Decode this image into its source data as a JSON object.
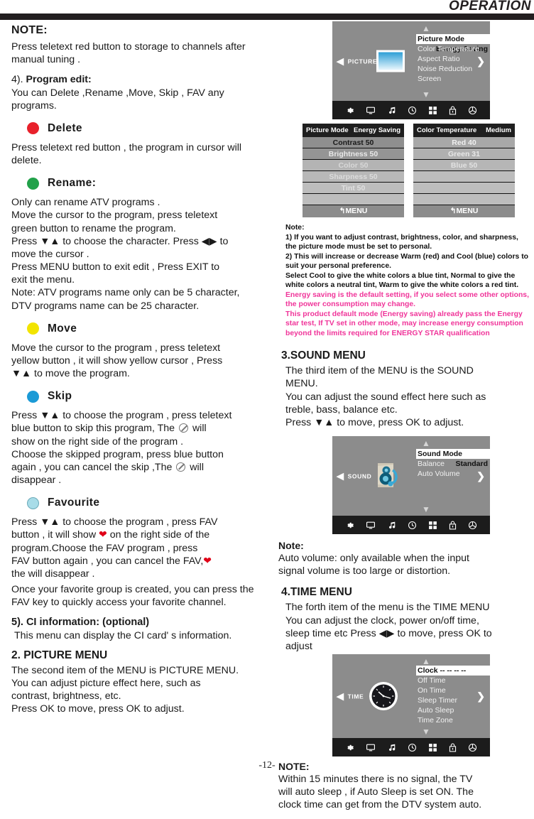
{
  "header": {
    "title": "OPERATION"
  },
  "page_number": "-12-",
  "left_column": {
    "note_heading": "NOTE:",
    "note_text": "Press  teletext red  button to storage to channels after manual tuning .",
    "program_edit": {
      "number": "4). ",
      "title": "Program  edit:",
      "text": "You can Delete ,Rename ,Move, Skip , FAV any programs."
    },
    "delete": {
      "dot_color": "#e8212b",
      "label": "Delete",
      "text": "Press  teletext red button , the  program in cursor will delete."
    },
    "rename": {
      "dot_color": "#22a14a",
      "label": "Rename:",
      "lines": [
        "Only can rename ATV programs .",
        "Move the cursor to the program, press teletext",
        "green button to rename the program.",
        "Press ▼▲ to choose the character.  Press ◀▶ to",
        "move the cursor .",
        "Press MENU button  to exit edit  , Press  EXIT to",
        "exit  the menu.",
        "Note: ATV programs name only can be 5 character,",
        "DTV programs name can  be 25  character."
      ]
    },
    "move": {
      "dot_color": "#f2e400",
      "label": "Move",
      "lines": [
        "Move the cursor to the program , press teletext",
        "yellow button , it will show yellow  cursor , Press",
        "▼▲ to move the program."
      ]
    },
    "skip": {
      "dot_color": "#1b9ad6",
      "label": "Skip",
      "line1": "Press ▼▲ to choose the program , press teletext",
      "line2a": "blue button to skip this program, The",
      "line2b": "will",
      "line3": "show on the right side of the program .",
      "line4": "Choose  the skipped program, press  blue button",
      "line5a": "again , you can  cancel the skip ,The",
      "line5b": "will",
      "line6": "disappear ."
    },
    "favourite": {
      "dot_color": "#a8dce8",
      "label": "Favourite",
      "line1a": "Press ▼▲ to choose the program , press FAV",
      "line2a": "button , it will show",
      "line2b": "on the right side of the",
      "line3": "program.Choose the FAV program , press",
      "line4a": "FAV button again , you can cancel the FAV,",
      "line5": "the will disappear .",
      "para2": "Once your favorite group is created, you can press the FAV key to quickly access your favorite channel."
    },
    "ci_info": {
      "title": "5). CI information: (optional)",
      "text": "This menu can display the CI card' s information."
    },
    "picture_menu": {
      "title": "2. PICTURE MENU",
      "lines": [
        "The second item of the MENU is PICTURE MENU.",
        "You can adjust picture effect here, such as",
        "contrast, brightness, etc.",
        "Press OK to move, press OK to adjust."
      ]
    }
  },
  "right_column": {
    "picture_osd": {
      "side_label": "PICTURE",
      "left_arrow": "◀",
      "right_arrow": "❯",
      "up_arrow": "▲",
      "down_arrow": "▼",
      "items": [
        {
          "label": "Picture Mode",
          "value": "Energy Saving",
          "selected": true
        },
        {
          "label": "Color Temperature",
          "value": "",
          "selected": false
        },
        {
          "label": "Aspect Ratio",
          "value": "",
          "selected": false
        },
        {
          "label": "Noise Reduction",
          "value": "",
          "selected": false
        },
        {
          "label": "Screen",
          "value": "",
          "selected": false
        }
      ],
      "icons": [
        "gear-icon",
        "monitor-icon",
        "music-note-icon",
        "clock-icon",
        "grid-icon",
        "lock-icon",
        "globe-icon"
      ]
    },
    "picture_mode_table": {
      "header_label": "Picture Mode",
      "header_value": "Energy Saving",
      "rows": [
        {
          "text": "Contrast 50",
          "bg": "#8f8f8f",
          "fg": "#1a1a1a"
        },
        {
          "text": "Brightness 50",
          "bg": "#959595",
          "fg": "#e8e8e8"
        },
        {
          "text": "Color 50",
          "bg": "#b4b4b4",
          "fg": "#d8d8d8"
        },
        {
          "text": "Sharpness 50",
          "bg": "#b8b8b8",
          "fg": "#dcdcdc"
        },
        {
          "text": "Tint 50",
          "bg": "#bdbdbd",
          "fg": "#e0e0e0"
        },
        {
          "text": "",
          "bg": "#bdbdbd",
          "fg": "#e0e0e0"
        }
      ],
      "menu_label": "MENU"
    },
    "color_temp_table": {
      "header_label": "Color Temperature",
      "header_value": "Medium",
      "rows": [
        {
          "text": "Red 40",
          "bg": "#a8a8a8",
          "fg": "#f0f0f0"
        },
        {
          "text": "Green 31",
          "bg": "#b0b0b0",
          "fg": "#e8e8e8"
        },
        {
          "text": "Blue 50",
          "bg": "#b6b6b6",
          "fg": "#e2e2e2"
        },
        {
          "text": "",
          "bg": "#bdbdbd",
          "fg": "#e0e0e0"
        },
        {
          "text": "",
          "bg": "#bdbdbd",
          "fg": "#e0e0e0"
        },
        {
          "text": "",
          "bg": "#bdbdbd",
          "fg": "#e0e0e0"
        }
      ],
      "menu_label": "MENU"
    },
    "picture_notes": {
      "label": "Note:",
      "lines": [
        "1) If you want to adjust contrast, brightness, color, and sharpness,",
        "the picture mode must be set to personal.",
        "2) This will increase or decrease Warm (red) and Cool (blue) colors to",
        "suit your personal preference.",
        "Select Cool to give the white colors a blue tint, Normal to give the",
        "white colors a neutral tint, Warm to give the white colors a red tint."
      ],
      "pink_lines": [
        "Energy saving is the default setting, if you select some other options,",
        "the power consumption may change.",
        "This product default mode (Energy saving) already pass the Energy",
        "star test, If TV set in other mode, may increase energy consumption",
        "beyond the limits required for ENERGY STAR qualification"
      ],
      "pink_color": "#f0359a"
    },
    "sound_menu": {
      "title": "3.SOUND MENU",
      "lines": [
        "The third item of the MENU is the SOUND",
        "MENU.",
        "You can adjust the sound effect here  such as",
        "treble, bass, balance etc.",
        "Press  ▼▲  to move, press OK to adjust."
      ]
    },
    "sound_osd": {
      "side_label": "SOUND",
      "items": [
        {
          "label": "Sound Mode",
          "value": "Standard",
          "selected": true
        },
        {
          "label": "Balance",
          "value": "",
          "selected": false
        },
        {
          "label": "Auto Volume",
          "value": "",
          "selected": false
        }
      ]
    },
    "sound_note": {
      "label": "Note:",
      "lines": [
        "Auto volume: only available when the input",
        "signal volume is too large or distortion."
      ]
    },
    "time_menu": {
      "title": "4.TIME MENU",
      "lines": [
        "The forth item of the menu is the TIME MENU",
        "You can adjust the clock, power on/off time,",
        "sleep time etc Press ◀▶ to move, press OK to",
        "adjust"
      ]
    },
    "time_osd": {
      "side_label": "TIME",
      "items": [
        {
          "label": "Clock",
          "value": "--   --   --   --",
          "selected": true
        },
        {
          "label": "Off Time",
          "value": "",
          "selected": false
        },
        {
          "label": "On Time",
          "value": "",
          "selected": false
        },
        {
          "label": "Sleep Timer",
          "value": "",
          "selected": false
        },
        {
          "label": "Auto Sleep",
          "value": "",
          "selected": false
        },
        {
          "label": "Time Zone",
          "value": "",
          "selected": false
        }
      ]
    },
    "time_note": {
      "label": "NOTE:",
      "lines": [
        "Within 15 minutes there is no signal,  the TV",
        "will auto sleep , if Auto Sleep is set ON. The",
        "clock time can get from the DTV system auto."
      ]
    }
  }
}
